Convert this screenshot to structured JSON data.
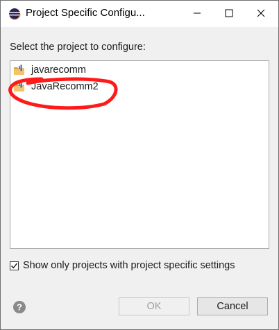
{
  "window": {
    "title": "Project Specific Configu...",
    "controls": {
      "minimize": "minimize-icon",
      "maximize": "maximize-icon",
      "close": "close-icon"
    }
  },
  "dialog": {
    "prompt": "Select the project to configure:",
    "projects": [
      {
        "name": "javarecomm",
        "icon": "project-folder-icon"
      },
      {
        "name": "JavaRecomm2",
        "icon": "project-folder-icon"
      }
    ],
    "show_only_checkbox": {
      "label": "Show only projects with project specific settings",
      "checked": true
    },
    "buttons": {
      "ok": "OK",
      "cancel": "Cancel",
      "ok_enabled": false
    },
    "help_icon": "help-icon"
  },
  "colors": {
    "annotation": "#ff1a1a",
    "window_bg": "#f0f0f0"
  }
}
